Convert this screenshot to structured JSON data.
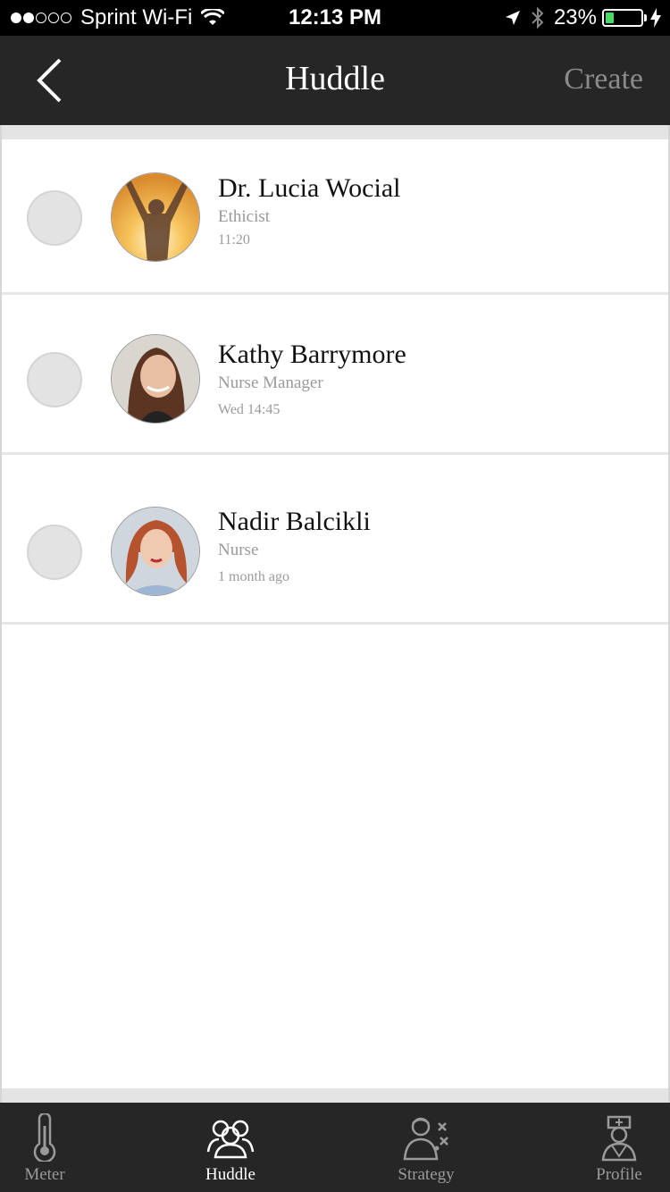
{
  "status_bar": {
    "carrier": "Sprint Wi-Fi",
    "time": "12:13 PM",
    "battery": "23%",
    "battery_level": 0.23,
    "signal_bars": 2,
    "icons": [
      "signal-dots-icon",
      "wifi-icon",
      "location-arrow-icon",
      "bluetooth-icon",
      "battery-icon",
      "charging-bolt-icon"
    ]
  },
  "nav": {
    "title": "Huddle",
    "create_label": "Create",
    "back_icon": "chevron-left-icon"
  },
  "contacts": [
    {
      "name": "Dr. Lucia Wocial",
      "role": "Ethicist",
      "time": "11:20",
      "selected": false
    },
    {
      "name": "Kathy Barrymore",
      "role": "Nurse Manager",
      "time": "Wed 14:45",
      "selected": false
    },
    {
      "name": "Nadir Balcikli",
      "role": "Nurse",
      "time": "1 month ago",
      "selected": false
    }
  ],
  "tabs": [
    {
      "label": "Meter",
      "icon": "thermometer-icon",
      "active": false
    },
    {
      "label": "Huddle",
      "icon": "group-icon",
      "active": true
    },
    {
      "label": "Strategy",
      "icon": "strategy-person-icon",
      "active": false
    },
    {
      "label": "Profile",
      "icon": "nurse-icon",
      "active": false
    }
  ],
  "colors": {
    "bar_background": "#262626",
    "battery_fill": "#4cd964",
    "inactive_text": "#9a9a9a",
    "active_text": "#ffffff"
  }
}
